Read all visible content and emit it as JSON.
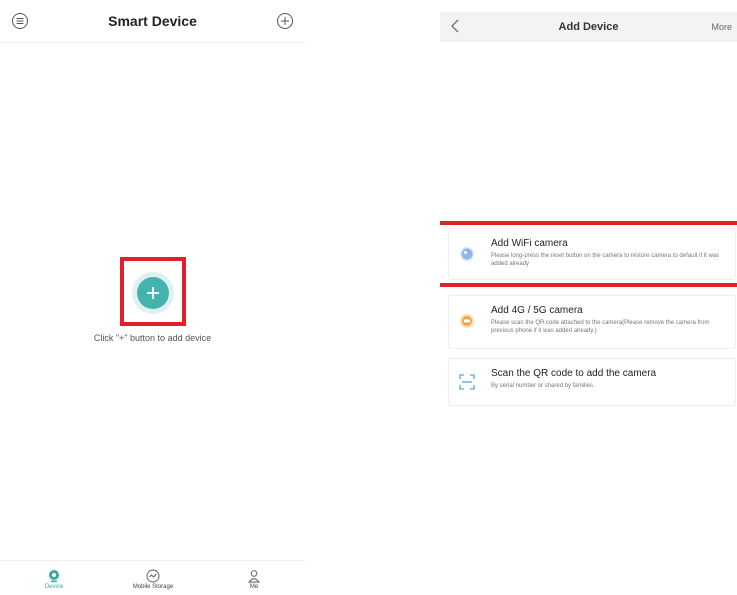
{
  "left": {
    "header": {
      "title": "Smart Device",
      "menu_icon": "menu-icon",
      "add_icon": "add-circle-icon"
    },
    "empty_state": {
      "hint": "Click \"+\" button to add device",
      "add_icon": "plus-icon"
    },
    "bottom_nav": [
      {
        "label": "Device",
        "icon": "camera-pin-icon",
        "active": true
      },
      {
        "label": "Mobile Storage",
        "icon": "storage-icon",
        "active": false
      },
      {
        "label": "Me",
        "icon": "person-icon",
        "active": false
      }
    ]
  },
  "right": {
    "header": {
      "title": "Add Device",
      "more_label": "More",
      "back_icon": "back-chevron-icon"
    },
    "options": [
      {
        "title": "Add WiFi camera",
        "desc": "Please long-press the reset button on the camera to restore camera to default if it was added already",
        "icon": "wifi-camera-icon",
        "highlighted": true
      },
      {
        "title": "Add 4G / 5G camera",
        "desc": "Please scan the QR code attached to the camera(Please remove the camera from previous phone if it was added already.)",
        "icon": "cellular-camera-icon",
        "highlighted": false
      },
      {
        "title": "Scan the QR code to add the camera",
        "desc": "By serial number or shared by families",
        "icon": "scan-icon",
        "highlighted": false
      }
    ]
  },
  "colors": {
    "accent": "#44b3ad",
    "highlight": "#e0212a"
  }
}
